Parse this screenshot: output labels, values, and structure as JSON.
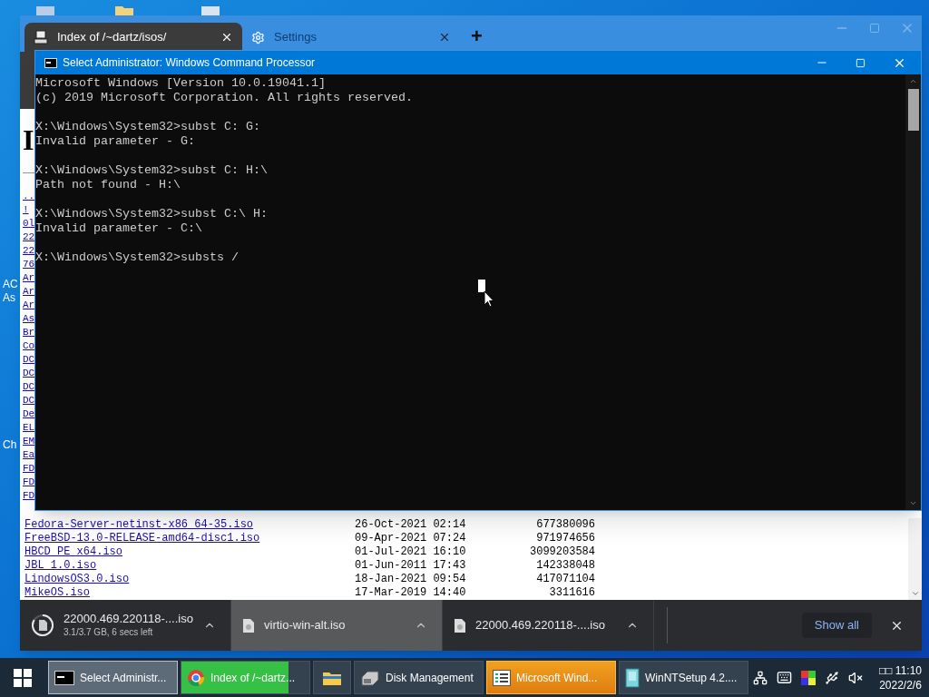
{
  "desktop": {
    "labels": [
      "AC",
      "As",
      "Ch"
    ]
  },
  "browser": {
    "tabs": [
      {
        "title": "Index of /~dartz/isos/",
        "kind": "page",
        "selected": true
      },
      {
        "title": "Settings",
        "kind": "settings",
        "selected": false
      }
    ],
    "new_tab": "+",
    "page": {
      "heading": "I",
      "clipped_links": [
        "..",
        "!",
        "0l",
        "22",
        "22",
        "76",
        "Ar",
        "Ar",
        "Ar",
        "As",
        "Br",
        "Co",
        "DC",
        "DC",
        "DC",
        "DC",
        "De",
        "EL",
        "EM",
        "Ea",
        "FD",
        "FD",
        "FD"
      ],
      "rows": [
        {
          "name": "Fedora-Server-netinst-x86_64-35.iso",
          "date": "26-Oct-2021 02:14",
          "size": "677380096"
        },
        {
          "name": "FreeBSD-13.0-RELEASE-amd64-disc1.iso",
          "date": "09-Apr-2021 07:24",
          "size": "971974656"
        },
        {
          "name": "HBCD_PE_x64.iso",
          "date": "01-Jul-2021 16:10",
          "size": "3099203584"
        },
        {
          "name": "JBL_1.0.iso",
          "date": "01-Jun-2011 17:43",
          "size": "142338048"
        },
        {
          "name": "LindowsOS3.0.iso",
          "date": "18-Jan-2021 09:54",
          "size": "417071104"
        },
        {
          "name": "MikeOS.iso",
          "date": "17-Mar-2019 14:40",
          "size": "3311616"
        }
      ]
    },
    "downloads": [
      {
        "name": "22000.469.220118-....iso",
        "status": "3.1/3.7 GB, 6 secs left",
        "kind": "progress",
        "level": 0.84,
        "selected": false
      },
      {
        "name": "virtio-win-alt.iso",
        "kind": "done",
        "selected": true
      },
      {
        "name": "22000.469.220118-....iso",
        "kind": "done",
        "selected": false
      }
    ],
    "show_all": "Show all"
  },
  "cmd": {
    "title": "Select Administrator: Windows Command Processor",
    "blocks": [
      [
        "Microsoft Windows [Version 10.0.19041.1]",
        "(c) 2019 Microsoft Corporation. All rights reserved."
      ],
      [
        "X:\\Windows\\System32>subst C: G:",
        "Invalid parameter - G:"
      ],
      [
        "X:\\Windows\\System32>subst C: H:\\",
        "Path not found - H:\\"
      ],
      [
        "X:\\Windows\\System32>subst C:\\ H:",
        "Invalid parameter - C:\\"
      ],
      [
        "X:\\Windows\\System32>substs /"
      ]
    ]
  },
  "taskbar": {
    "items": [
      {
        "kind": "cmd",
        "label": "Select Administr...",
        "selected": true,
        "flashing": false
      },
      {
        "kind": "chrome",
        "label": "Index of /~dartz...",
        "selected": false,
        "flashing": false,
        "level": 0.84
      },
      {
        "kind": "explorer",
        "selected": false,
        "flashing": false
      },
      {
        "kind": "disk",
        "label": "Disk Management",
        "selected": false,
        "flashing": false
      },
      {
        "kind": "doc",
        "label": "Microsoft Wind...",
        "selected": false,
        "flashing": true
      },
      {
        "kind": "setup",
        "label": "WinNTSetup 4.2....",
        "selected": false,
        "flashing": false
      }
    ],
    "clock": {
      "time": "□□ 11:10",
      "date": "2022/2/6"
    }
  }
}
